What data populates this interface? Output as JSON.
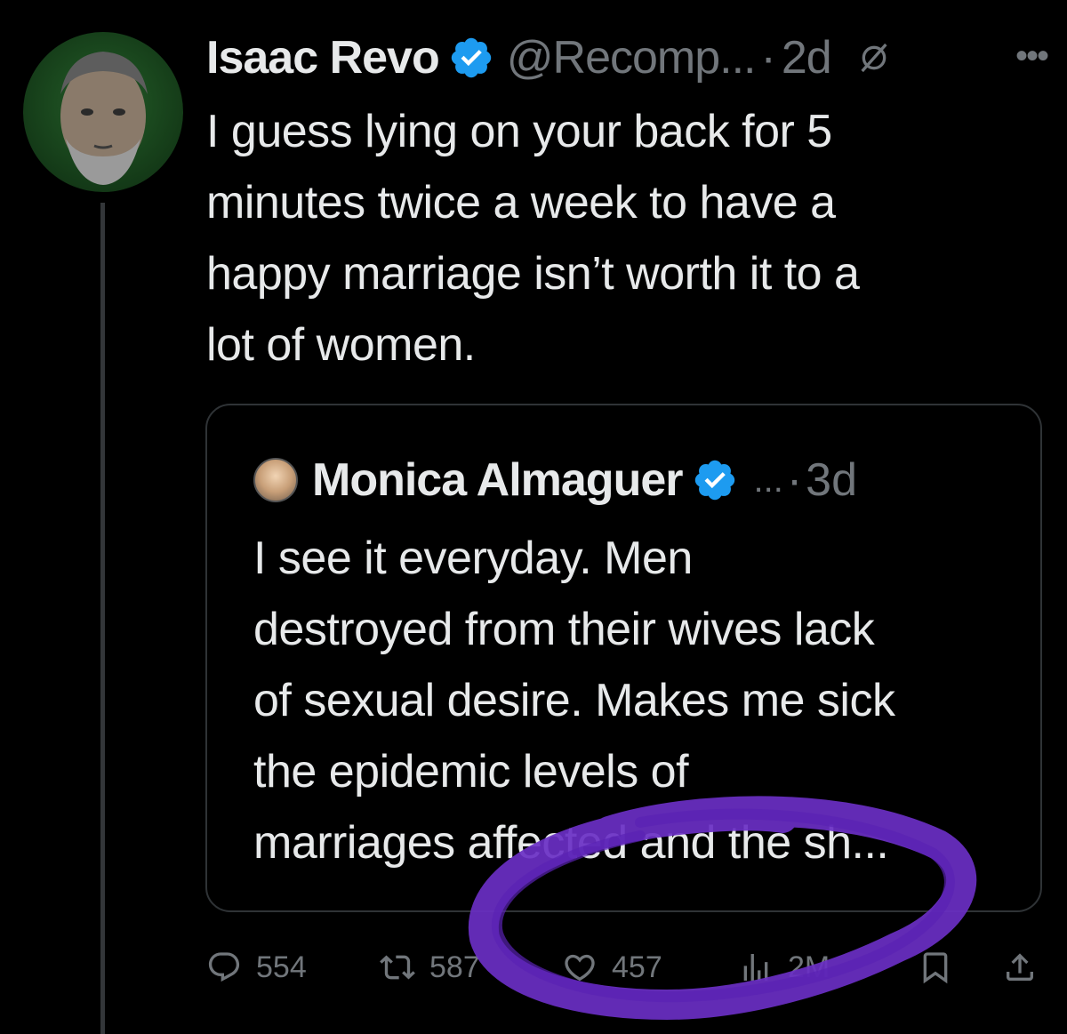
{
  "tweet": {
    "author_name": "Isaac Revo",
    "handle": "@Recomp...",
    "separator": "·",
    "time": "2d",
    "text_lines": [
      "I guess lying on your back for 5",
      "minutes twice a week to have a",
      "happy marriage isn’t worth it to a",
      "lot of women."
    ],
    "icons": {
      "verified": "verified-badge-icon",
      "grok": "grok-icon",
      "more": "more-icon"
    }
  },
  "quote": {
    "author_name": "Monica Almaguer",
    "ellipsis": "...",
    "separator": "·",
    "time": "3d",
    "text_lines": [
      "I see it everyday. Men",
      "destroyed from their wives lack",
      "of sexual desire. Makes me sick",
      "the epidemic levels of",
      "marriages affected and the sh..."
    ]
  },
  "actions": {
    "replies": "554",
    "reposts": "587",
    "likes": "457",
    "views": "2M"
  },
  "colors": {
    "background": "#000000",
    "text": "#e7e9ea",
    "muted": "#71767b",
    "verified": "#1d9bf0",
    "scribble": "#6a2fc4"
  }
}
